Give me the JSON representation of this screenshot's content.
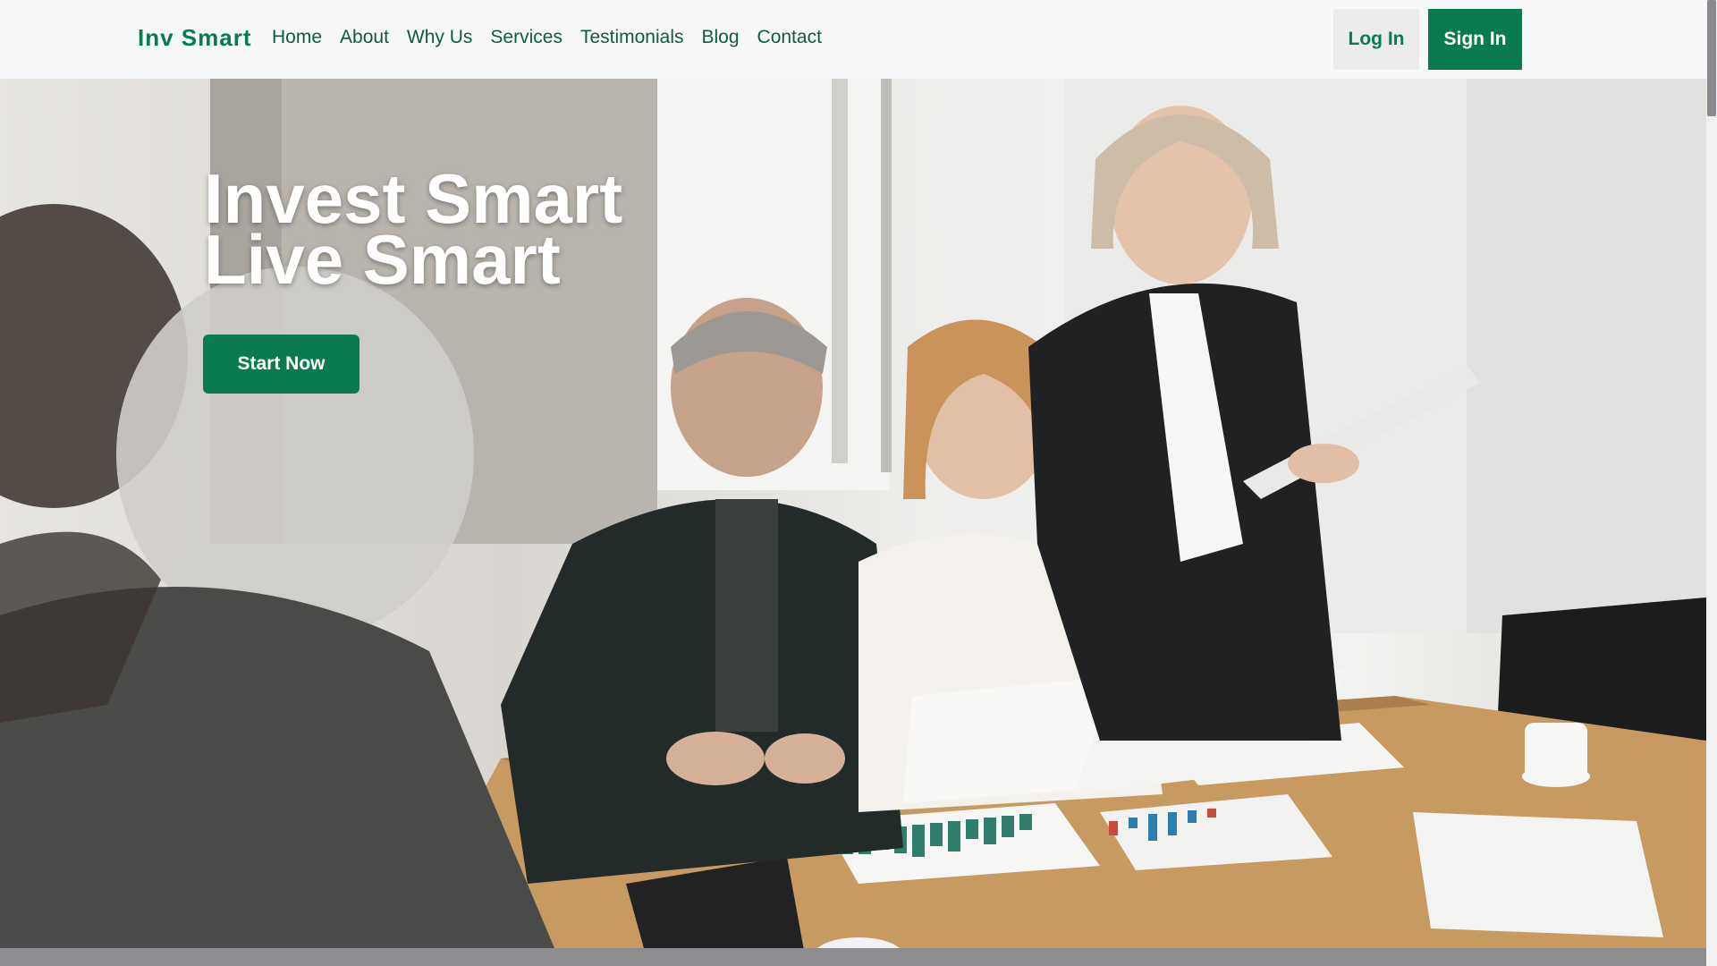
{
  "navbar": {
    "brand": "Inv Smart",
    "links": [
      "Home",
      "About",
      "Why Us",
      "Services",
      "Testimonials",
      "Blog",
      "Contact"
    ],
    "login_label": "Log In",
    "signin_label": "Sign In"
  },
  "hero": {
    "title_line1": "Invest Smart",
    "title_line2": "Live Smart",
    "cta_label": "Start Now",
    "image_subject": "business-team-meeting-photo"
  },
  "colors": {
    "brand_green": "#0a7a4f",
    "nav_bg": "#f7f8fa",
    "login_bg": "#ececec"
  }
}
